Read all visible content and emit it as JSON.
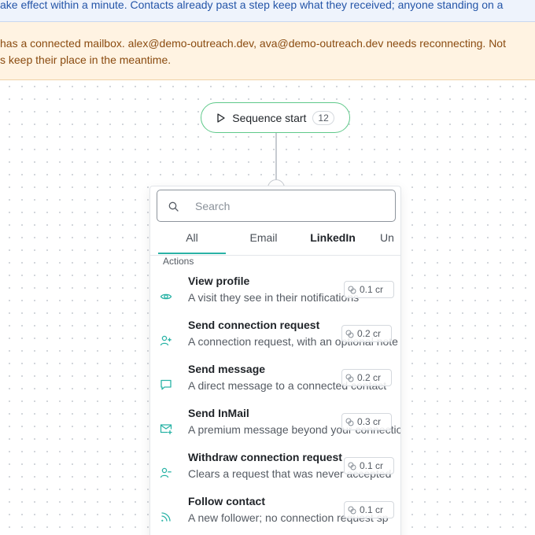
{
  "banners": {
    "info": "ake effect within a minute. Contacts already past a step keep what they received; anyone standing on a",
    "warn_line1": "has a connected mailbox. alex@demo-outreach.dev, ava@demo-outreach.dev needs reconnecting. Not",
    "warn_line2": "s keep their place in the meantime."
  },
  "start_node": {
    "label": "Sequence start",
    "count": "12",
    "icon": "play-icon"
  },
  "picker": {
    "search": {
      "placeholder": "Search",
      "value": "",
      "icon": "search-icon"
    },
    "tabs": [
      {
        "label": "All",
        "active": true
      },
      {
        "label": "Email",
        "active": false
      },
      {
        "label": "LinkedIn",
        "active": false
      },
      {
        "label": "Un",
        "active": false
      }
    ],
    "section": "Actions",
    "items": [
      {
        "title": "View profile",
        "desc": "A visit they see in their notifications",
        "cost": "0.1 cr",
        "icon": "eye-icon"
      },
      {
        "title": "Send connection request",
        "desc": "A connection request, with an optional note",
        "cost": "0.2 cr",
        "icon": "user-plus-icon"
      },
      {
        "title": "Send message",
        "desc": "A direct message to a connected contact",
        "cost": "0.2 cr",
        "icon": "message-icon"
      },
      {
        "title": "Send InMail",
        "desc": "A premium message beyond your connections",
        "cost": "0.3 cr",
        "icon": "mail-plus-icon"
      },
      {
        "title": "Withdraw connection request",
        "desc": "Clears a request that was never accepted",
        "cost": "0.1 cr",
        "icon": "user-minus-icon"
      },
      {
        "title": "Follow contact",
        "desc": "A new follower; no connection request sp",
        "cost": "0.1 cr",
        "icon": "rss-icon"
      }
    ]
  },
  "colors": {
    "accent": "#2ab3a6",
    "start_border": "#5fc98a",
    "info_text": "#2455a8",
    "warn_text": "#8a4b10"
  }
}
